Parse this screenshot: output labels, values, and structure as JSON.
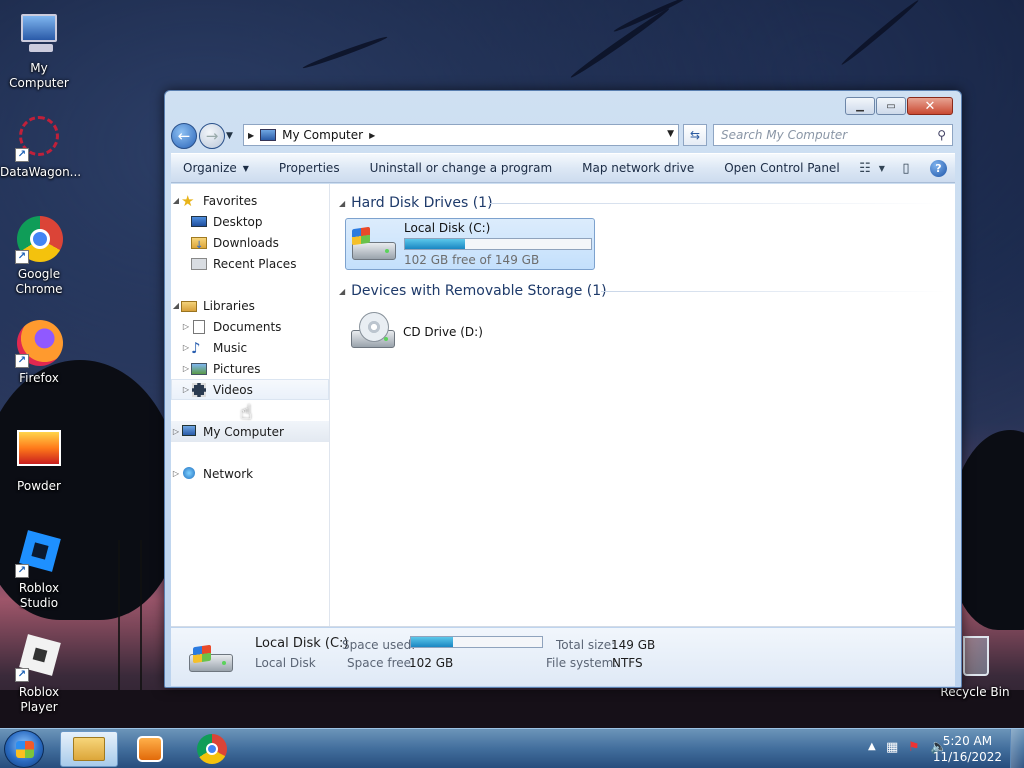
{
  "desktop": {
    "icons": [
      {
        "label": "My Computer",
        "icon": "my-computer-icon"
      },
      {
        "label": "DataWagon...",
        "icon": "datawagon-icon"
      },
      {
        "label": "Google Chrome",
        "icon": "chrome-icon"
      },
      {
        "label": "Firefox",
        "icon": "firefox-icon"
      },
      {
        "label": "Powder",
        "icon": "powder-icon"
      },
      {
        "label": "Roblox Studio",
        "icon": "roblox-studio-icon"
      },
      {
        "label": "Roblox Player",
        "icon": "roblox-player-icon"
      },
      {
        "label": "Recycle Bin",
        "icon": "recycle-bin-icon"
      }
    ]
  },
  "window": {
    "address": "My Computer",
    "search_placeholder": "Search My Computer",
    "toolbar": {
      "organize": "Organize",
      "properties": "Properties",
      "uninstall": "Uninstall or change a program",
      "map_drive": "Map network drive",
      "control_panel": "Open Control Panel"
    },
    "nav": {
      "favorites": "Favorites",
      "desktop": "Desktop",
      "downloads": "Downloads",
      "recent": "Recent Places",
      "libraries": "Libraries",
      "documents": "Documents",
      "music": "Music",
      "pictures": "Pictures",
      "videos": "Videos",
      "computer": "My Computer",
      "network": "Network"
    },
    "groups": {
      "hdd": "Hard Disk Drives (1)",
      "removable": "Devices with Removable Storage (1)"
    },
    "drives": {
      "c_name": "Local Disk (C:)",
      "c_free": "102 GB free of 149 GB",
      "c_used_fraction": 0.32,
      "d_name": "CD Drive (D:)"
    },
    "details": {
      "name": "Local Disk (C:)",
      "type": "Local Disk",
      "space_used_label": "Space used:",
      "space_free_label": "Space free:",
      "space_free": "102 GB",
      "total_label": "Total size:",
      "total": "149 GB",
      "fs_label": "File system:",
      "fs": "NTFS"
    }
  },
  "taskbar": {
    "time": "5:20 AM",
    "date": "11/16/2022"
  },
  "colors": {
    "accent": "#1a86c2",
    "selection": "#c4e0fc"
  }
}
